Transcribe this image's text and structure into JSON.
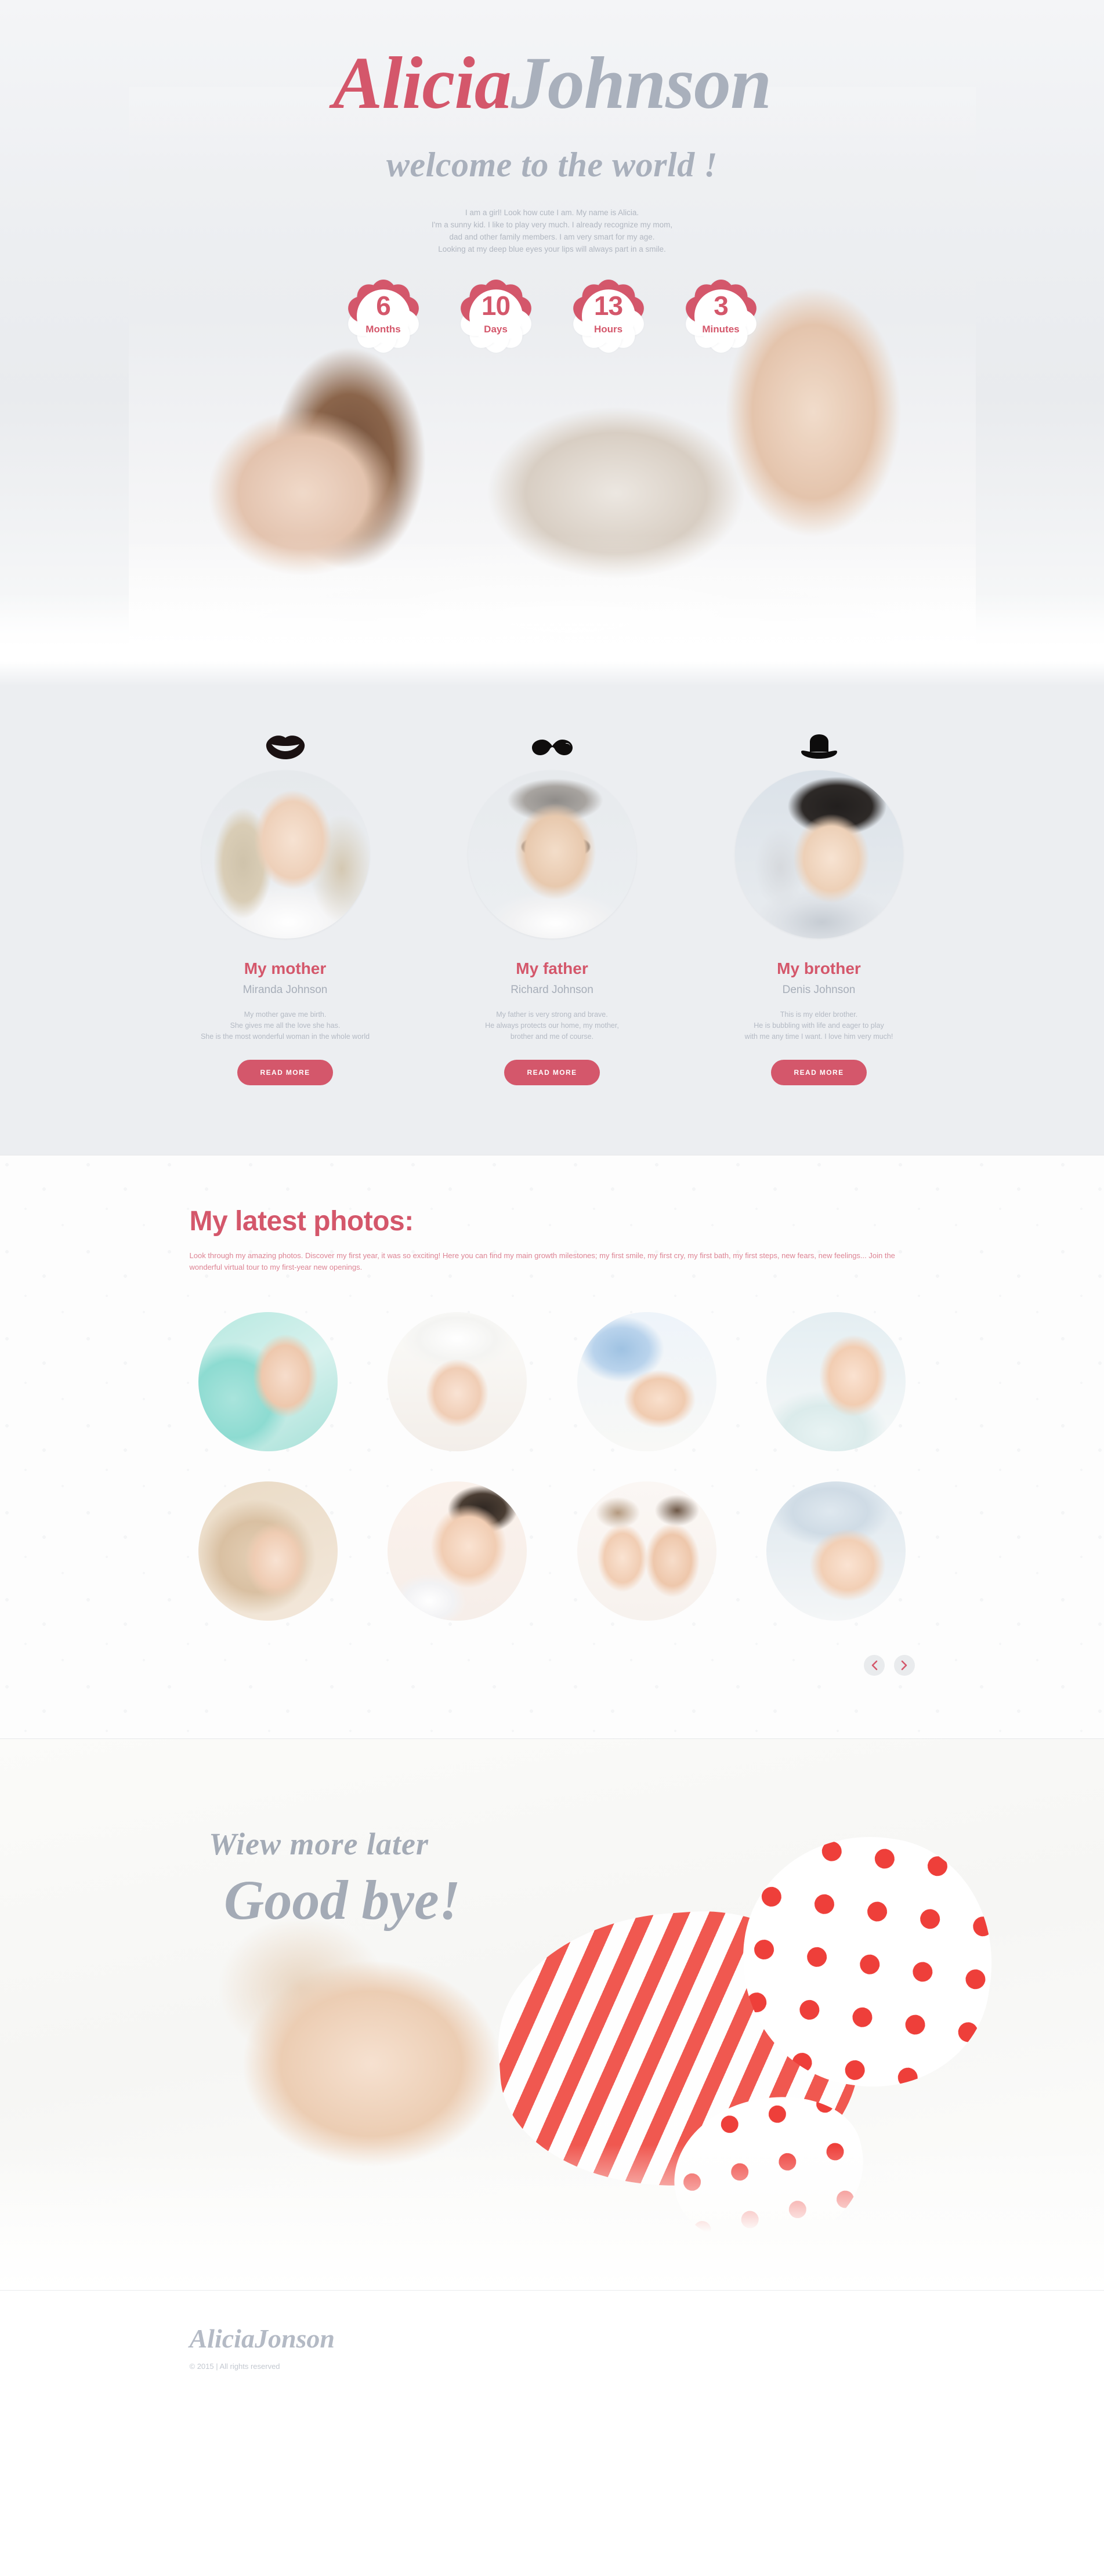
{
  "hero": {
    "title_accent": "Alicia",
    "title_muted": "Johnson",
    "subtitle": "welcome to the world !",
    "intro_lines": [
      "I am a girl! Look how cute I am. My name is Alicia.",
      "I'm a sunny kid. I like to play very much. I already recognize my mom,",
      "dad and other family members. I am very smart for my age.",
      "Looking at my deep blue eyes your lips will always part in a smile."
    ],
    "photo_alt": "baby-lying-on-white-rug"
  },
  "countdown": {
    "items": [
      {
        "value": "6",
        "label": "Months"
      },
      {
        "value": "10",
        "label": "Days"
      },
      {
        "value": "13",
        "label": "Hours"
      },
      {
        "value": "3",
        "label": "Minutes"
      }
    ]
  },
  "family": {
    "members": [
      {
        "icon": "lips-icon",
        "title": "My mother",
        "name": "Miranda Johnson",
        "desc_lines": [
          "My mother gave me birth.",
          "She gives me all the love she has.",
          "She is the most wonderful woman in the whole world"
        ],
        "button": "READ MORE"
      },
      {
        "icon": "mustache-icon",
        "title": "My father",
        "name": "Richard Johnson",
        "desc_lines": [
          "My father is very strong and brave.",
          "He always protects our home, my mother,",
          "brother and me of course."
        ],
        "button": "READ MORE"
      },
      {
        "icon": "bowler-hat-icon",
        "title": "My brother",
        "name": "Denis Johnson",
        "desc_lines": [
          "This is my elder brother.",
          "He is bubbling with life and eager to play",
          "with me any time I want. I love him very much!"
        ],
        "button": "READ MORE"
      }
    ]
  },
  "gallery": {
    "heading": "My latest photos:",
    "description": "Look through my amazing photos. Discover my first year, it was so exciting! Here you can find my main growth milestones; my first smile, my first cry, my first bath, my first steps, new fears, new feelings... Join the wonderful virtual tour to my first-year new openings.",
    "photos": [
      {
        "alt": "baby-feet-in-mint-blanket"
      },
      {
        "alt": "laughing-baby-under-white-towel"
      },
      {
        "alt": "sleeping-baby-in-blue-knit-hat"
      },
      {
        "alt": "baby-with-blue-eyes-in-white-blanket"
      },
      {
        "alt": "baby-wrapped-in-beige-towel"
      },
      {
        "alt": "baby-drinking-from-bottle"
      },
      {
        "alt": "mother-and-baby-cheek-to-cheek"
      },
      {
        "alt": "baby-lying-on-blue-blanket"
      }
    ],
    "prev_label": "Previous",
    "next_label": "Next"
  },
  "goodbye": {
    "line1": "Wiew more later",
    "line2": "Good bye!",
    "photo_alt": "baby-in-red-striped-and-polka-dot-outfit"
  },
  "footer": {
    "logo": "AliciaJonson",
    "copyright": "© 2015 | All rights reserved"
  },
  "colors": {
    "accent": "#d4576b",
    "muted": "#a9b0bc",
    "background": "#eceef1",
    "red": "#ee3f3a"
  }
}
